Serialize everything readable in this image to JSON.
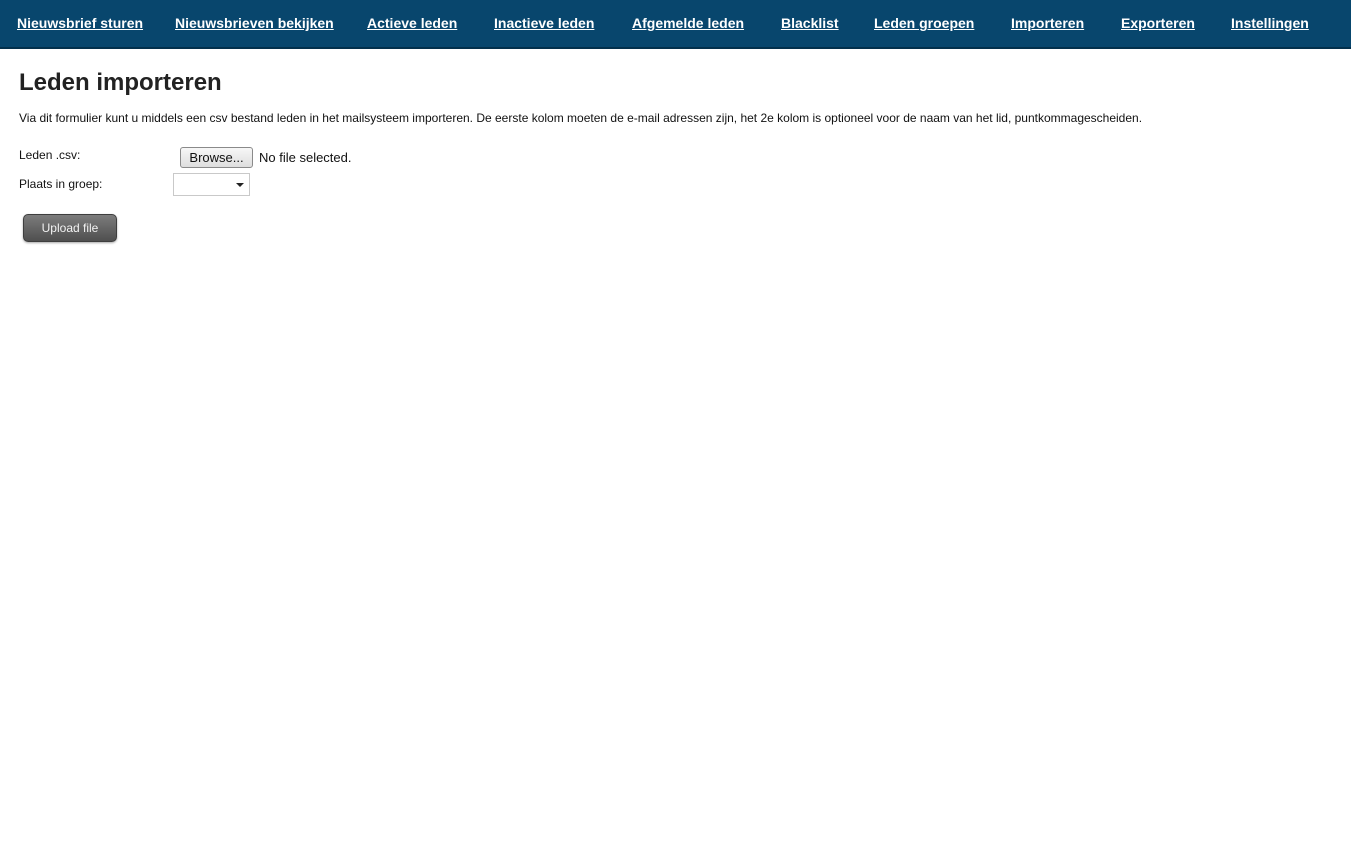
{
  "nav": {
    "items": [
      {
        "label": "Nieuwsbrief sturen"
      },
      {
        "label": "Nieuwsbrieven bekijken"
      },
      {
        "label": "Actieve leden"
      },
      {
        "label": "Inactieve leden"
      },
      {
        "label": "Afgemelde leden"
      },
      {
        "label": "Blacklist"
      },
      {
        "label": "Leden groepen"
      },
      {
        "label": "Importeren"
      },
      {
        "label": "Exporteren"
      },
      {
        "label": "Instellingen"
      }
    ],
    "background_color": "#08466d",
    "text_color": "#ffffff"
  },
  "main": {
    "title": "Leden importeren",
    "intro": "Via dit formulier kunt u middels een csv bestand leden in het mailsysteem importeren. De eerste kolom moeten de e-mail adressen zijn, het 2e kolom is optioneel voor de naam van het lid, puntkommagescheiden.",
    "form": {
      "file_label": "Leden .csv:",
      "browse_label": "Browse...",
      "file_status": "No file selected.",
      "group_label": "Plaats in groep:",
      "group_selected": "",
      "upload_label": "Upload file"
    }
  }
}
